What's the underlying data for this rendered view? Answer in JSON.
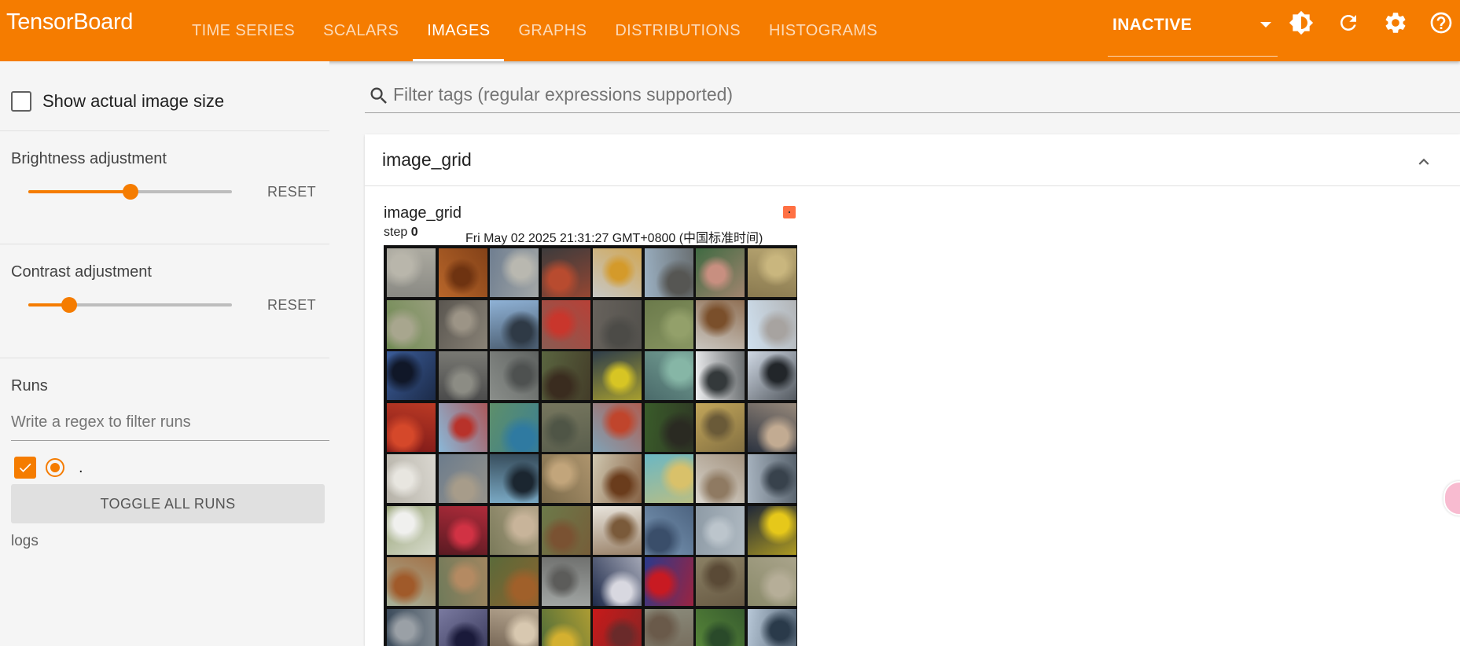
{
  "app": {
    "brand": "TensorBoard"
  },
  "tabs": [
    {
      "label": "TIME SERIES",
      "active": false
    },
    {
      "label": "SCALARS",
      "active": false
    },
    {
      "label": "IMAGES",
      "active": true
    },
    {
      "label": "GRAPHS",
      "active": false
    },
    {
      "label": "DISTRIBUTIONS",
      "active": false
    },
    {
      "label": "HISTOGRAMS",
      "active": false
    }
  ],
  "toolbar": {
    "status": "INACTIVE",
    "icons": [
      "theme-icon",
      "reload-icon",
      "settings-icon",
      "help-icon"
    ]
  },
  "sidebar": {
    "show_actual_size_label": "Show actual image size",
    "show_actual_size_checked": false,
    "brightness": {
      "label": "Brightness adjustment",
      "reset_label": "RESET",
      "value_fraction": 0.5
    },
    "contrast": {
      "label": "Contrast adjustment",
      "reset_label": "RESET",
      "value_fraction": 0.2
    },
    "runs": {
      "title": "Runs",
      "filter_placeholder": "Write a regex to filter runs",
      "items": [
        {
          "name": ".",
          "checked": true,
          "selected": true
        }
      ],
      "toggle_all_label": "TOGGLE ALL RUNS",
      "logdir_label": "logs"
    }
  },
  "main": {
    "tag_filter_placeholder": "Filter tags (regular expressions supported)",
    "group": {
      "title": "image_grid",
      "card": {
        "title": "image_grid",
        "step_label": "step",
        "step_value": "0",
        "timestamp": "Fri May 02 2025 21:31:27 GMT+0800 (中国标准时间)",
        "run_color": "#ff7043"
      }
    }
  },
  "colors": {
    "accent": "#f57c00",
    "run_color": "#ff7043"
  },
  "image_tiles": [
    [
      "#8a8a84",
      "#b9b6ab"
    ],
    [
      "#b8662a",
      "#6e3311"
    ],
    [
      "#6f7e90",
      "#b9b8b0"
    ],
    [
      "#3c3b3c",
      "#b84b2f"
    ],
    [
      "#c7c7c5",
      "#d49a2a"
    ],
    [
      "#9bb0c2",
      "#565653"
    ],
    [
      "#3f6a42",
      "#c88f80"
    ],
    [
      "#8a7a50",
      "#c9b67e"
    ],
    [
      "#6f8a52",
      "#a8a68e"
    ],
    [
      "#5a5650",
      "#9c9486"
    ],
    [
      "#8fb2d6",
      "#2f3a46"
    ],
    [
      "#8a5b52",
      "#c9362c"
    ],
    [
      "#67625c",
      "#4c4b47"
    ],
    [
      "#6b7a4b",
      "#93a06a"
    ],
    [
      "#c9c6c0",
      "#7a4f2b"
    ],
    [
      "#cfe0ef",
      "#a7a3a0"
    ],
    [
      "#3b5d9a",
      "#101728"
    ],
    [
      "#4b4b4b",
      "#8c8c84"
    ],
    [
      "#8a8e8a",
      "#4e5150"
    ],
    [
      "#5a6540",
      "#3a2c1f"
    ],
    [
      "#2e3d4b",
      "#d7c524"
    ],
    [
      "#4a6a6a",
      "#86b6a6"
    ],
    [
      "#ecedef",
      "#34393b"
    ],
    [
      "#cfd8e4",
      "#22262a"
    ],
    [
      "#7c1818",
      "#d5482a"
    ],
    [
      "#8ab8d8",
      "#b8322a"
    ],
    [
      "#5e8f6a",
      "#2f7aa1"
    ],
    [
      "#76765e",
      "#4f5546"
    ],
    [
      "#80a2b6",
      "#c0452c"
    ],
    [
      "#3a5c2a",
      "#2a2a22"
    ],
    [
      "#c2a65a",
      "#6a5a38"
    ],
    [
      "#2c3340",
      "#c2ab92"
    ],
    [
      "#b6b2a8",
      "#e8e6e0"
    ],
    [
      "#6c7c8c",
      "#a79c8a"
    ],
    [
      "#7aa9c4",
      "#1b2630"
    ],
    [
      "#7a6a4a",
      "#c2a57b"
    ],
    [
      "#cfc7b0",
      "#6a3c1c"
    ],
    [
      "#6ab7c4",
      "#d9c16a"
    ],
    [
      "#d8d4cc",
      "#8f7a62"
    ],
    [
      "#a8b4c0",
      "#38424c"
    ],
    [
      "#9aa67a",
      "#f0f0ee"
    ],
    [
      "#5a1a22",
      "#d13244"
    ],
    [
      "#7a7a5a",
      "#c8b49a"
    ],
    [
      "#6c7a4a",
      "#7a5232"
    ],
    [
      "#e8e4dc",
      "#7a5a3a"
    ],
    [
      "#7c9ab8",
      "#3a4e6a"
    ],
    [
      "#8e9ba6",
      "#bcc5cc"
    ],
    [
      "#202838",
      "#e6c81a"
    ],
    [
      "#a8b29a",
      "#a05a2a"
    ],
    [
      "#6f7a5a",
      "#b48a62"
    ],
    [
      "#5a6a3a",
      "#a0602a"
    ],
    [
      "#a2a6a4",
      "#5c5c5a"
    ],
    [
      "#1e2a4a",
      "#d8d8e0"
    ],
    [
      "#2a3a8c",
      "#c81a22"
    ],
    [
      "#8a8064",
      "#5a4a36"
    ],
    [
      "#8a8a6a",
      "#b6ae98"
    ],
    [
      "#3a4a5a",
      "#9aa0a6"
    ],
    [
      "#7a7aa0",
      "#1a1a3a"
    ],
    [
      "#6a5a4a",
      "#d8c8b0"
    ],
    [
      "#4a6a3a",
      "#d4b030"
    ],
    [
      "#c81a1a",
      "#6a2a2a"
    ],
    [
      "#8a8a7a",
      "#6a5a4a"
    ],
    [
      "#5a8a3a",
      "#2a4a2a"
    ],
    [
      "#b8c8d8",
      "#2a3a4a"
    ]
  ]
}
